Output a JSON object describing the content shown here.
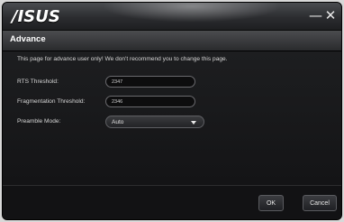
{
  "titlebar": {
    "logo": "/ISUS",
    "minimize_icon": "—",
    "close_icon": "✕"
  },
  "header": {
    "title": "Advance"
  },
  "main": {
    "notice": "This page for advance user only! We don't recommend you to change this page.",
    "rts": {
      "label": "RTS Threshold:",
      "value": "2347"
    },
    "fragmentation": {
      "label": "Fragmentation Threshold:",
      "value": "2346"
    },
    "preamble": {
      "label": "Preamble Mode:",
      "selected": "Auto"
    }
  },
  "footer": {
    "ok_label": "OK",
    "cancel_label": "Cancel"
  },
  "colors": {
    "background": "#141416",
    "titlebar": "#2b2c2f",
    "text": "#d6d6d6",
    "field_border": "#6a6a6e"
  }
}
